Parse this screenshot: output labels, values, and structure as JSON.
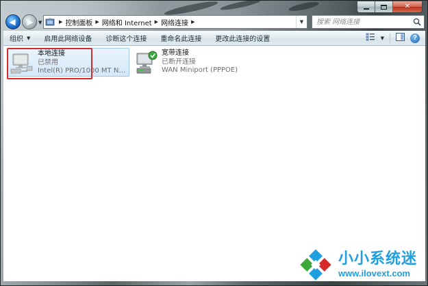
{
  "window": {
    "caption_buttons": {
      "minimize_icon": "minimize-icon",
      "maximize_icon": "maximize-icon",
      "close_icon": "close-icon",
      "close_glyph": "✕"
    }
  },
  "navigation": {
    "back_icon": "back-arrow-icon",
    "forward_icon": "forward-arrow-icon",
    "back_glyph": "◀",
    "forward_glyph": "▶"
  },
  "address_bar": {
    "breadcrumbs": [
      "控制面板",
      "网络和 Internet",
      "网络连接"
    ],
    "separator": "▶",
    "dropdown_glyph": "▼",
    "refresh_glyph": "↻"
  },
  "search": {
    "placeholder": "搜索 网络连接"
  },
  "toolbar": {
    "organize_label": "组织",
    "organize_arrow": "▼",
    "items": [
      "启用此网络设备",
      "诊断这个连接",
      "重命名此连接",
      "更改此连接的设置"
    ],
    "view_arrow": "▼",
    "help_glyph": "?"
  },
  "connections": [
    {
      "name": "本地连接",
      "status": "已禁用",
      "device": "Intel(R) PRO/1000 MT Networ...",
      "selected": true,
      "icon": "local-connection-disabled-icon"
    },
    {
      "name": "宽带连接",
      "status": "已断开连接",
      "device": "WAN Miniport (PPPOE)",
      "selected": false,
      "icon": "broadband-connection-icon"
    }
  ],
  "watermark": {
    "title": "小小系统迷",
    "url": "www.ilovext.com"
  },
  "colors": {
    "accent": "#1e9fe0",
    "highlight_border": "#d62a2a",
    "selection_fill": "#d4e8f9"
  }
}
